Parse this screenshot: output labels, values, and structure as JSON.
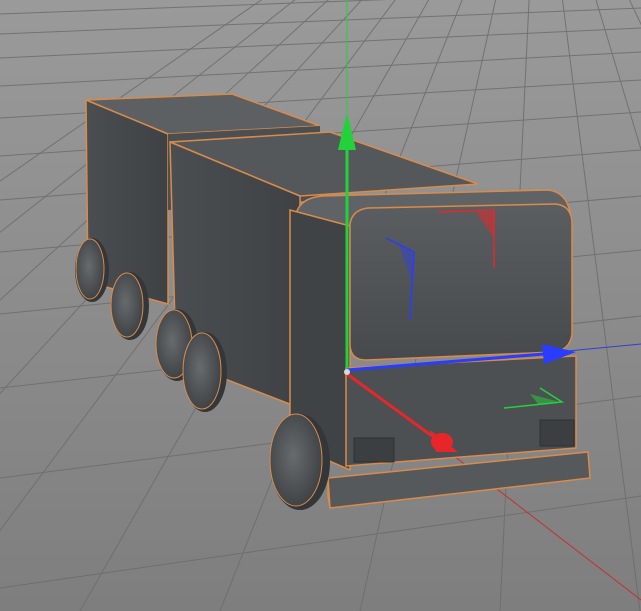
{
  "viewport": {
    "name": "3D viewport",
    "background_color": "#8b8b8b",
    "grid_color": "#6f6f6f",
    "grid_visible": true
  },
  "model": {
    "name": "truck",
    "color": "#4f5356",
    "selection_outline_color": "#d98b4a",
    "selected": true
  },
  "gizmo": {
    "type": "move",
    "x_axis_color": "#e8262a",
    "y_axis_color": "#23d23a",
    "z_axis_color": "#2a3cff"
  }
}
